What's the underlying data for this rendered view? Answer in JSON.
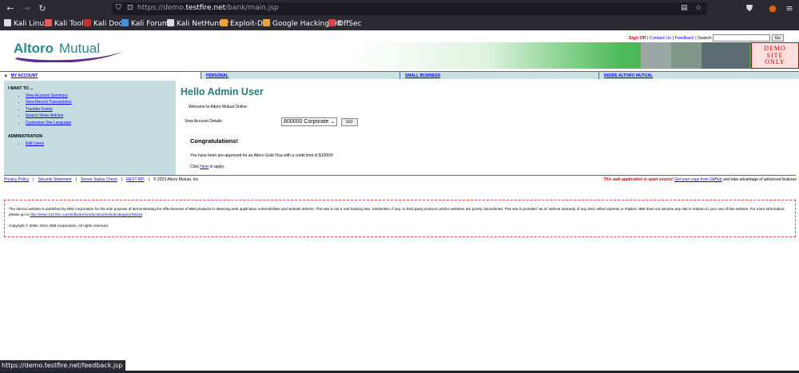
{
  "browser": {
    "url_prefix": "https://demo.",
    "url_host": "testfire.net",
    "url_path": "/bank/main.jsp",
    "bookmarks": [
      {
        "label": "Kali Linux",
        "icon": "kali-dragon-icon",
        "color": "#dcdcdc"
      },
      {
        "label": "Kali Tools",
        "icon": "kali-tools-icon",
        "color": "#e05c5c"
      },
      {
        "label": "Kali Docs",
        "icon": "kali-docs-icon",
        "color": "#c9302c"
      },
      {
        "label": "Kali Forums",
        "icon": "kali-forums-icon",
        "color": "#4a8fd6"
      },
      {
        "label": "Kali NetHunter",
        "icon": "kali-nethunter-icon",
        "color": "#dcdcdc"
      },
      {
        "label": "Exploit-DB",
        "icon": "exploit-db-icon",
        "color": "#e8a33b"
      },
      {
        "label": "Google Hacking DB",
        "icon": "ghdb-icon",
        "color": "#e8a33b"
      },
      {
        "label": "OffSec",
        "icon": "offsec-icon",
        "color": "#d64545"
      }
    ],
    "status_url": "https://demo.testfire.net/feedback.jsp"
  },
  "site": {
    "logo_text_a": "Altoro",
    "logo_text_b": "Mutual",
    "top_links": {
      "sign_off": "Sign Off",
      "contact": "Contact Us",
      "feedback": "Feedback",
      "search_label": "Search",
      "search_value": "",
      "go": "Go"
    },
    "demo_badge": [
      "DEMO",
      "SITE",
      "ONLY"
    ],
    "tabs": [
      {
        "label": "MY ACCOUNT",
        "active": true
      },
      {
        "label": "PERSONAL",
        "active": false
      },
      {
        "label": "SMALL BUSINESS",
        "active": false
      },
      {
        "label": "INSIDE ALTORO MUTUAL",
        "active": false
      }
    ],
    "sidebar": {
      "heading1": "I WANT TO ...",
      "items1": [
        "View Account Summary",
        "View Recent Transactions",
        "Transfer Funds",
        "Search News Articles",
        "Customize Site Language"
      ],
      "heading2": "ADMINISTRATION",
      "items2": [
        "Edit Users"
      ]
    },
    "main": {
      "hello": "Hello Admin User",
      "welcome": "Welcome to Altoro Mutual Online.",
      "view_account_label": "View Account Details:",
      "account_selected": "800000 Corporate",
      "go_button": "GO",
      "congrats": "Congratulations!",
      "approved_text": "You have been pre-approved for an Altoro Gold Visa with a credit limit of $10000!",
      "apply_prefix": "Click ",
      "apply_link": "Here",
      "apply_suffix": " to apply."
    },
    "footer": {
      "links": [
        "Privacy Policy",
        "Security Statement",
        "Server Status Check",
        "REST API"
      ],
      "copyright": "© 2023 Altoro Mutual, Inc.",
      "open_source_text": "This web application is open source!",
      "github_link": "Get your copy from GitHub",
      "github_suffix": " and take advantage of advanced features"
    },
    "disclaimer": {
      "text": "The AltoroJ website is published by IBM Corporation for the sole purpose of demonstrating the effectiveness of IBM products in detecting web application vulnerabilities and website defects. This site is not a real banking site. Similarities, if any, to third party products and/or websites are purely coincidental. This site is provided \"as is\" without warranty of any kind, either express or implied. IBM does not assume any risk in relation to your use of this website. For more information, please go to ",
      "link": "http://www-142.ibm.com/software/products/us/en/subcategory/SWI10",
      "link_suffix": ".",
      "copyright": "Copyright © 2008, 2023, IBM Corporation, All rights reserved."
    }
  }
}
